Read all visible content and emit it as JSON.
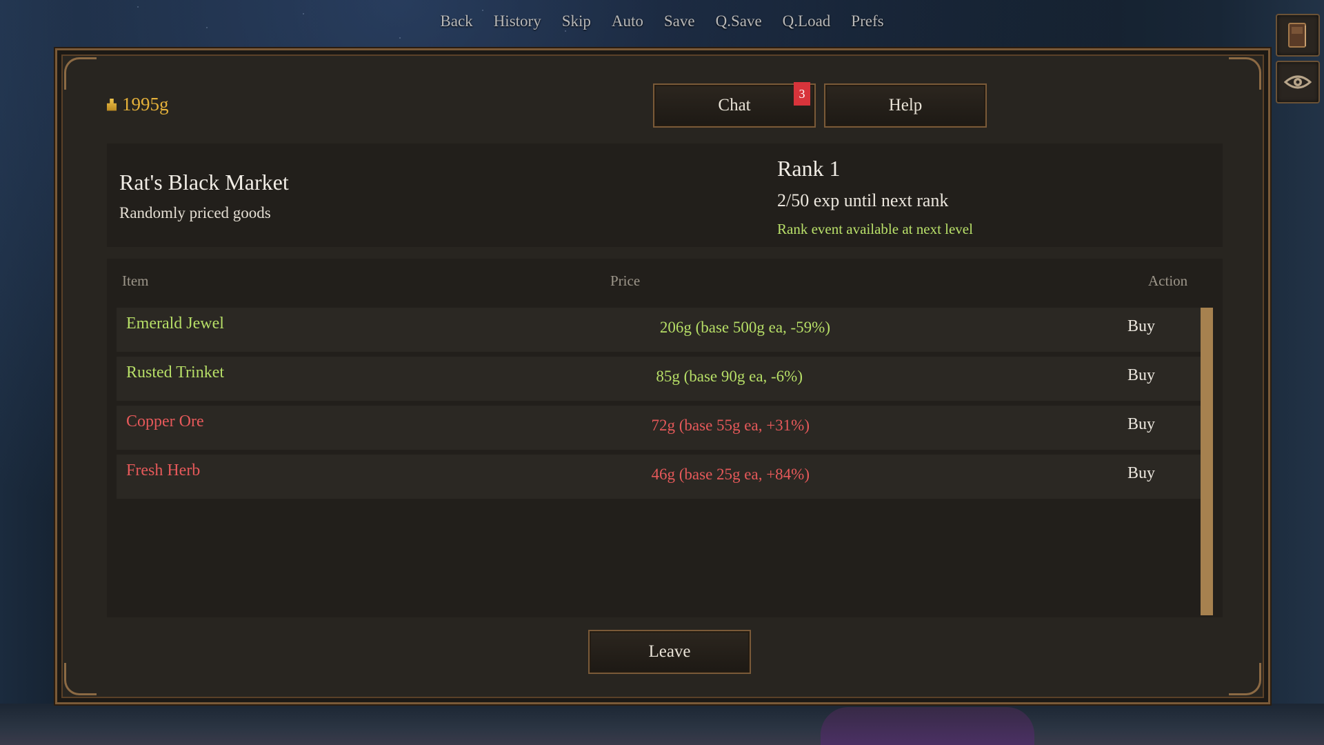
{
  "quick_menu": [
    "Back",
    "History",
    "Skip",
    "Auto",
    "Save",
    "Q.Save",
    "Q.Load",
    "Prefs"
  ],
  "side_buttons": {
    "book_icon": "book-icon",
    "eye_icon": "eye-icon"
  },
  "gold": {
    "amount": "1995g",
    "icon": "coin-stack-icon"
  },
  "buttons": {
    "chat": "Chat",
    "chat_badge": "3",
    "help": "Help",
    "leave": "Leave"
  },
  "market": {
    "title": "Rat's Black Market",
    "subtitle": "Randomly priced goods"
  },
  "rank": {
    "title": "Rank 1",
    "exp": "2/50 exp until next rank",
    "event": "Rank event available at next level"
  },
  "table": {
    "headers": {
      "item": "Item",
      "price": "Price",
      "action": "Action"
    },
    "rows": [
      {
        "name": "Emerald Jewel",
        "price": "206g (base 500g ea, -59%)",
        "action": "Buy",
        "tone": "green"
      },
      {
        "name": "Rusted Trinket",
        "price": "85g (base 90g ea, -6%)",
        "action": "Buy",
        "tone": "green"
      },
      {
        "name": "Copper Ore",
        "price": "72g (base 55g ea, +31%)",
        "action": "Buy",
        "tone": "red"
      },
      {
        "name": "Fresh Herb",
        "price": "46g (base 25g ea, +84%)",
        "action": "Buy",
        "tone": "red"
      }
    ]
  },
  "colors": {
    "discount": "#b7df67",
    "markup": "#e6595a",
    "gold": "#e6b23a",
    "frame": "#7a5a38"
  }
}
